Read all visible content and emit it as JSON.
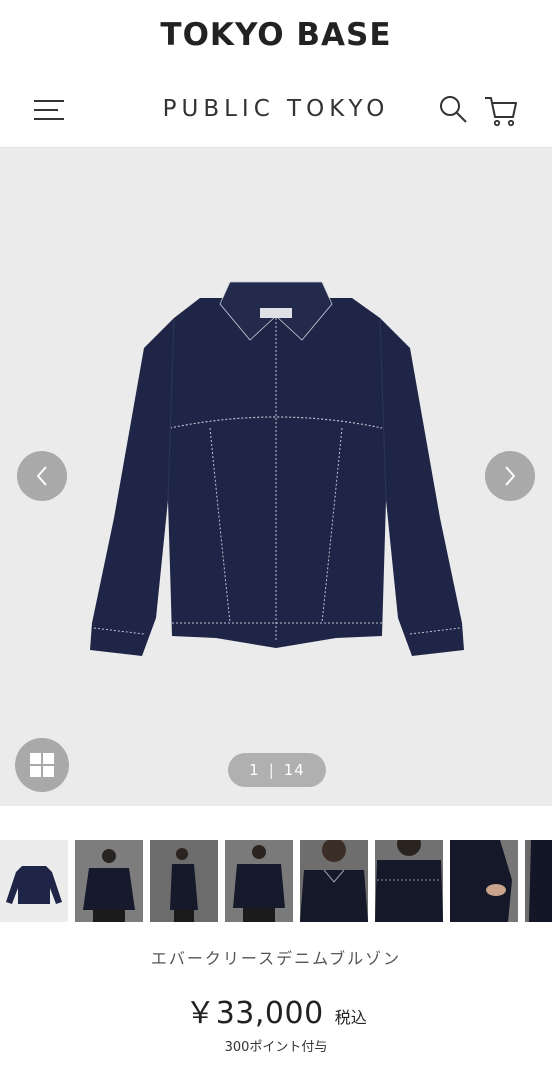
{
  "header": {
    "brand": "TOKYO BASE"
  },
  "nav": {
    "store_name": "PUBLIC TOKYO"
  },
  "gallery": {
    "current": "1",
    "separator": "|",
    "total": "14"
  },
  "product": {
    "name": "エバークリースデニムブルゾン",
    "price": "￥33,000",
    "tax_label": "税込",
    "points": "300ポイント付与"
  },
  "colors": {
    "denim": "#1e2546",
    "gallery_bg": "#ebebeb",
    "button": "#a9a9a9"
  }
}
